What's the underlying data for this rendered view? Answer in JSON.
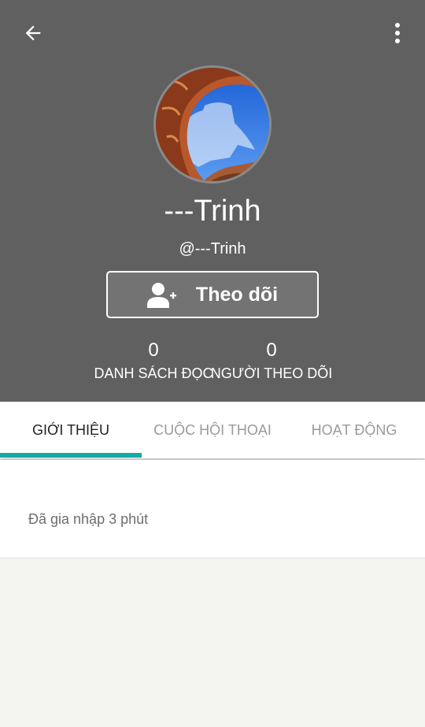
{
  "header": {
    "display_name": "---Trinh",
    "username": "@---Trinh",
    "follow_label": "Theo dõi",
    "bg_color": "#606060"
  },
  "stats": [
    {
      "value": "0",
      "label": "DANH SÁCH ĐỌC"
    },
    {
      "value": "0",
      "label": "NGƯỜI THEO DÕI"
    }
  ],
  "tabs": [
    {
      "label": "GIỚI THIỆU",
      "active": true
    },
    {
      "label": "CUỘC HỘI THOẠI",
      "active": false
    },
    {
      "label": "HOẠT ĐỘNG",
      "active": false
    }
  ],
  "about": {
    "joined_text": "Đã gia nhập 3 phút"
  },
  "icons": {
    "back": "arrow-back-icon",
    "more": "more-vertical-icon",
    "follow": "person-add-icon"
  },
  "colors": {
    "accent": "#17a9a7"
  }
}
